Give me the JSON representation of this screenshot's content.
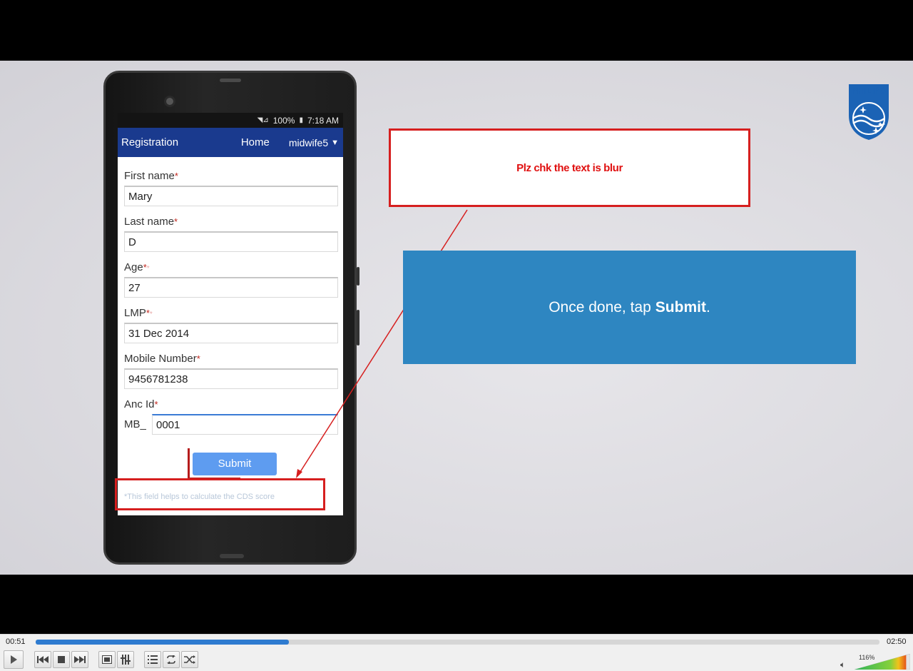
{
  "phone": {
    "status": {
      "battery": "100%",
      "time": "7:18 AM"
    },
    "appbar": {
      "title": "Registration",
      "home": "Home",
      "user": "midwife5",
      "caret": "▼"
    },
    "fields": [
      {
        "label": "First name",
        "value": "Mary"
      },
      {
        "label": "Last name",
        "value": "D"
      },
      {
        "label": "Age",
        "value": "27"
      },
      {
        "label": "LMP",
        "value": "31 Dec 2014"
      },
      {
        "label": "Mobile Number",
        "value": "9456781238"
      },
      {
        "label": "Anc Id",
        "prefix": "MB_",
        "value": "0001"
      }
    ],
    "required_mark": "*",
    "submit_label": "Submit",
    "footnote": "*This field helps to calculate the CDS score"
  },
  "annotation": {
    "comment": "Plz chk the text is blur"
  },
  "banner": {
    "text": "Once done, tap",
    "bold": "Submit",
    "end": "."
  },
  "logo": {
    "text": "PHILIPS"
  },
  "player": {
    "current_time": "00:51",
    "duration": "02:50",
    "progress": 0.3,
    "volume_label": "116%",
    "volume": 1.16,
    "buttons": [
      "play-icon",
      "previous-icon",
      "stop-icon",
      "next-icon",
      "fullscreen-icon",
      "extended-settings-icon",
      "playlist-icon",
      "loop-icon",
      "shuffle-icon"
    ]
  },
  "colors": {
    "appbar": "#1a3a8e",
    "banner": "#2e86c1",
    "annotation_red": "#d61f1f",
    "seek_fill": "#2e7bd0",
    "submit": "#5e9cf0"
  }
}
